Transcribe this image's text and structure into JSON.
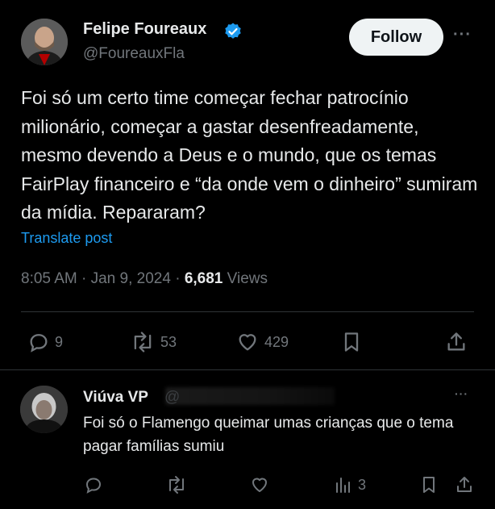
{
  "tweet": {
    "author_name": "Felipe Foureaux",
    "author_handle": "@FoureauxFla",
    "follow_label": "Follow",
    "text": "Foi só um certo time começar fechar patrocínio milionário, começar a gastar desenfreadamente, mesmo devendo a Deus e o mundo, que os temas FairPlay financeiro e “da onde vem o dinheiro” sumiram da mídia. Repararam?",
    "translate_label": "Translate post",
    "time": "8:05 AM",
    "date": "Jan 9, 2024",
    "views_count": "6,681",
    "views_label": "Views",
    "separator": "·",
    "more_icon": "···",
    "replies": "9",
    "reposts": "53",
    "likes": "429"
  },
  "reply": {
    "author_name": "Viúva VP",
    "at_sign": "@",
    "text": "Foi só o Flamengo queimar umas crianças que o tema pagar famílias sumiu",
    "views": "3",
    "more_icon": "···"
  },
  "colors": {
    "background": "#000000",
    "text": "#e7e9ea",
    "muted": "#71767b",
    "link": "#1d9bf0",
    "verified": "#1d9bf0"
  },
  "icons": [
    "verified-badge-icon",
    "reply-icon",
    "repost-icon",
    "like-icon",
    "bookmark-icon",
    "share-icon",
    "views-icon",
    "more-icon"
  ]
}
